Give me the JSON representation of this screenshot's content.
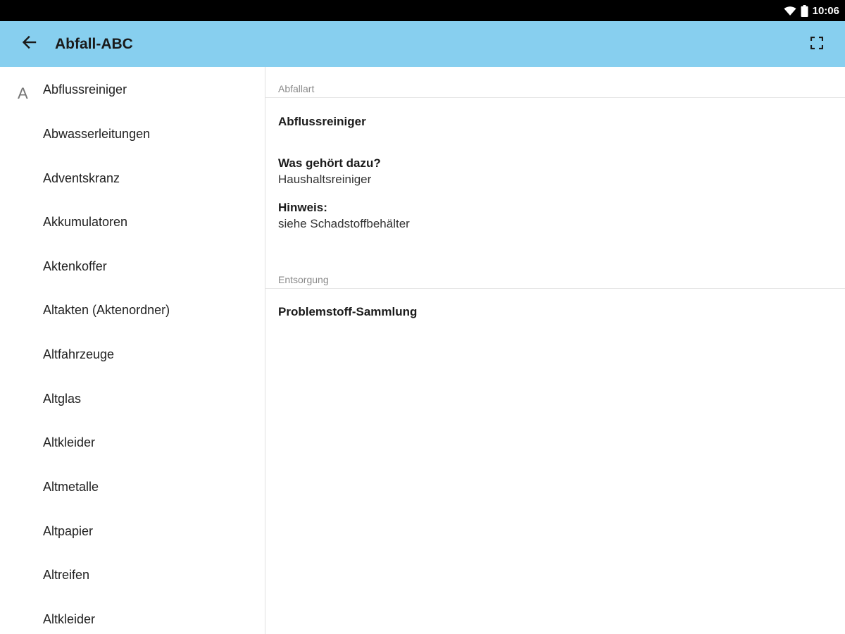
{
  "status_bar": {
    "time": "10:06",
    "icons": [
      "wifi-icon",
      "battery-icon"
    ]
  },
  "toolbar": {
    "title": "Abfall-ABC",
    "back_icon": "arrow-left-icon",
    "fullscreen_icon": "fullscreen-icon",
    "background_color": "#87cfef"
  },
  "index": {
    "letter": "A",
    "items": [
      {
        "label": "Abflussreiniger"
      },
      {
        "label": "Abwasserleitungen"
      },
      {
        "label": "Adventskranz"
      },
      {
        "label": "Akkumulatoren"
      },
      {
        "label": "Aktenkoffer"
      },
      {
        "label": "Altakten (Aktenordner)"
      },
      {
        "label": "Altfahrzeuge"
      },
      {
        "label": "Altglas"
      },
      {
        "label": "Altkleider"
      },
      {
        "label": "Altmetalle"
      },
      {
        "label": "Altpapier"
      },
      {
        "label": "Altreifen"
      },
      {
        "label": "Altkleider"
      }
    ]
  },
  "detail": {
    "waste_type_header": "Abfallart",
    "waste_type_value": "Abflussreiniger",
    "includes_label": "Was gehört dazu?",
    "includes_value": "Haushaltsreiniger",
    "note_label": "Hinweis:",
    "note_value": "siehe Schadstoffbehälter",
    "disposal_header": "Entsorgung",
    "disposal_value": "Problemstoff-Sammlung"
  }
}
